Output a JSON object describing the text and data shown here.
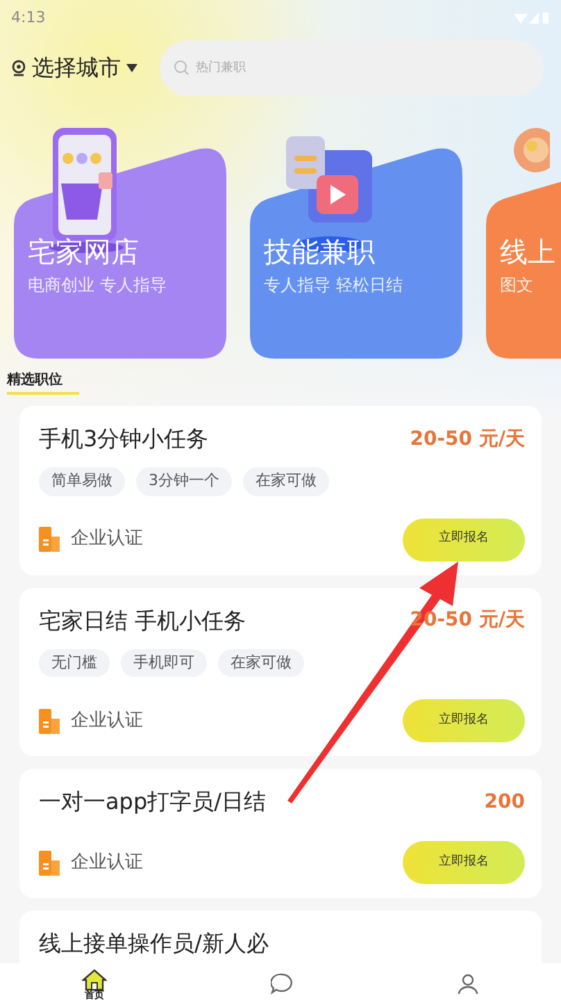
{
  "status_bar": {
    "time": "4:13"
  },
  "header": {
    "city": "选择城市",
    "search": {
      "placeholder": "热门兼职"
    }
  },
  "categories": [
    {
      "kind": "shop",
      "title": "宅家网店",
      "subtitle": "电商创业 专人指导",
      "color": "#a585f2"
    },
    {
      "kind": "video",
      "title": "技能兼职",
      "subtitle": "专人指导 轻松日结",
      "color": "#6491f0"
    },
    {
      "kind": "megaphone",
      "title": "线上",
      "subtitle": "图文",
      "color": "#f5854a"
    }
  ],
  "section_title": "精选职位",
  "jobs": [
    {
      "title": "手机3分钟小任务",
      "salary": "20-50 元/天",
      "tags": [
        "简单易做",
        "3分钟一个",
        "在家可做"
      ],
      "verified": "企业认证",
      "button": "立即报名"
    },
    {
      "title": "宅家日结 手机小任务",
      "salary": "20-50 元/天",
      "tags": [
        "无门槛",
        "手机即可",
        "在家可做"
      ],
      "verified": "企业认证",
      "button": "立即报名"
    },
    {
      "title": "一对一app打字员/日结",
      "salary": "200",
      "verified": "企业认证",
      "button": "立即报名"
    },
    {
      "title": "线上接单操作员/新人必"
    }
  ],
  "bottom_nav": [
    {
      "kind": "home",
      "label": "首页",
      "selected": true
    },
    {
      "kind": "message",
      "selected": false
    },
    {
      "kind": "profile",
      "selected": false
    }
  ]
}
